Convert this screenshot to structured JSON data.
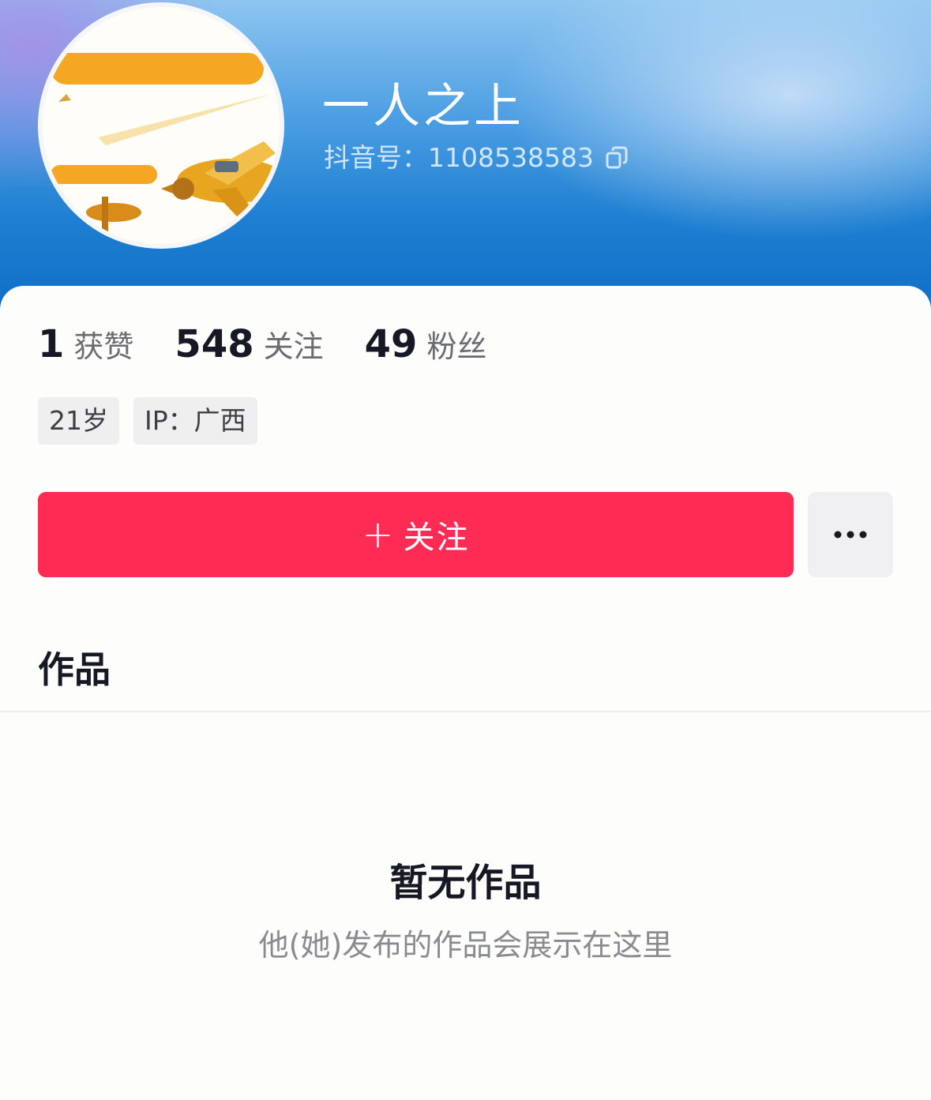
{
  "profile": {
    "name": "一人之上",
    "douyin_id": "抖音号：1108538583",
    "copy_icon": "copy-icon",
    "avatar_icon": "airplane-avatar"
  },
  "stats": [
    {
      "value": "1",
      "label": "获赞"
    },
    {
      "value": "548",
      "label": "关注"
    },
    {
      "value": "49",
      "label": "粉丝"
    }
  ],
  "tags": [
    "21岁",
    "IP：广西"
  ],
  "actions": {
    "follow_plus": "+",
    "follow_label": "关注",
    "more_icon": "more-dots-icon"
  },
  "tabs": {
    "works": "作品"
  },
  "empty": {
    "title": "暂无作品",
    "subtitle": "他(她)发布的作品会展示在这里"
  },
  "colors": {
    "accent": "#fe2c55",
    "header_blue": "#0a6bc2"
  }
}
